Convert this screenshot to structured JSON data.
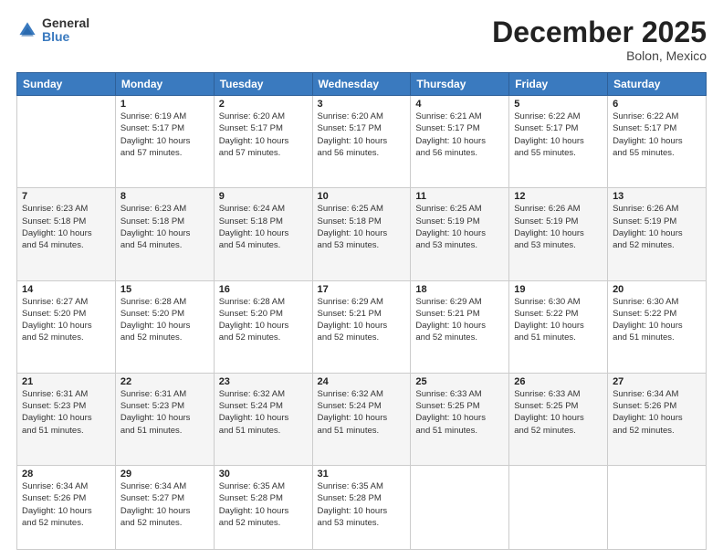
{
  "header": {
    "logo_general": "General",
    "logo_blue": "Blue",
    "month_year": "December 2025",
    "location": "Bolon, Mexico"
  },
  "days_of_week": [
    "Sunday",
    "Monday",
    "Tuesday",
    "Wednesday",
    "Thursday",
    "Friday",
    "Saturday"
  ],
  "weeks": [
    [
      {
        "day": "",
        "info": ""
      },
      {
        "day": "1",
        "info": "Sunrise: 6:19 AM\nSunset: 5:17 PM\nDaylight: 10 hours\nand 57 minutes."
      },
      {
        "day": "2",
        "info": "Sunrise: 6:20 AM\nSunset: 5:17 PM\nDaylight: 10 hours\nand 57 minutes."
      },
      {
        "day": "3",
        "info": "Sunrise: 6:20 AM\nSunset: 5:17 PM\nDaylight: 10 hours\nand 56 minutes."
      },
      {
        "day": "4",
        "info": "Sunrise: 6:21 AM\nSunset: 5:17 PM\nDaylight: 10 hours\nand 56 minutes."
      },
      {
        "day": "5",
        "info": "Sunrise: 6:22 AM\nSunset: 5:17 PM\nDaylight: 10 hours\nand 55 minutes."
      },
      {
        "day": "6",
        "info": "Sunrise: 6:22 AM\nSunset: 5:17 PM\nDaylight: 10 hours\nand 55 minutes."
      }
    ],
    [
      {
        "day": "7",
        "info": "Sunrise: 6:23 AM\nSunset: 5:18 PM\nDaylight: 10 hours\nand 54 minutes."
      },
      {
        "day": "8",
        "info": "Sunrise: 6:23 AM\nSunset: 5:18 PM\nDaylight: 10 hours\nand 54 minutes."
      },
      {
        "day": "9",
        "info": "Sunrise: 6:24 AM\nSunset: 5:18 PM\nDaylight: 10 hours\nand 54 minutes."
      },
      {
        "day": "10",
        "info": "Sunrise: 6:25 AM\nSunset: 5:18 PM\nDaylight: 10 hours\nand 53 minutes."
      },
      {
        "day": "11",
        "info": "Sunrise: 6:25 AM\nSunset: 5:19 PM\nDaylight: 10 hours\nand 53 minutes."
      },
      {
        "day": "12",
        "info": "Sunrise: 6:26 AM\nSunset: 5:19 PM\nDaylight: 10 hours\nand 53 minutes."
      },
      {
        "day": "13",
        "info": "Sunrise: 6:26 AM\nSunset: 5:19 PM\nDaylight: 10 hours\nand 52 minutes."
      }
    ],
    [
      {
        "day": "14",
        "info": "Sunrise: 6:27 AM\nSunset: 5:20 PM\nDaylight: 10 hours\nand 52 minutes."
      },
      {
        "day": "15",
        "info": "Sunrise: 6:28 AM\nSunset: 5:20 PM\nDaylight: 10 hours\nand 52 minutes."
      },
      {
        "day": "16",
        "info": "Sunrise: 6:28 AM\nSunset: 5:20 PM\nDaylight: 10 hours\nand 52 minutes."
      },
      {
        "day": "17",
        "info": "Sunrise: 6:29 AM\nSunset: 5:21 PM\nDaylight: 10 hours\nand 52 minutes."
      },
      {
        "day": "18",
        "info": "Sunrise: 6:29 AM\nSunset: 5:21 PM\nDaylight: 10 hours\nand 52 minutes."
      },
      {
        "day": "19",
        "info": "Sunrise: 6:30 AM\nSunset: 5:22 PM\nDaylight: 10 hours\nand 51 minutes."
      },
      {
        "day": "20",
        "info": "Sunrise: 6:30 AM\nSunset: 5:22 PM\nDaylight: 10 hours\nand 51 minutes."
      }
    ],
    [
      {
        "day": "21",
        "info": "Sunrise: 6:31 AM\nSunset: 5:23 PM\nDaylight: 10 hours\nand 51 minutes."
      },
      {
        "day": "22",
        "info": "Sunrise: 6:31 AM\nSunset: 5:23 PM\nDaylight: 10 hours\nand 51 minutes."
      },
      {
        "day": "23",
        "info": "Sunrise: 6:32 AM\nSunset: 5:24 PM\nDaylight: 10 hours\nand 51 minutes."
      },
      {
        "day": "24",
        "info": "Sunrise: 6:32 AM\nSunset: 5:24 PM\nDaylight: 10 hours\nand 51 minutes."
      },
      {
        "day": "25",
        "info": "Sunrise: 6:33 AM\nSunset: 5:25 PM\nDaylight: 10 hours\nand 51 minutes."
      },
      {
        "day": "26",
        "info": "Sunrise: 6:33 AM\nSunset: 5:25 PM\nDaylight: 10 hours\nand 52 minutes."
      },
      {
        "day": "27",
        "info": "Sunrise: 6:34 AM\nSunset: 5:26 PM\nDaylight: 10 hours\nand 52 minutes."
      }
    ],
    [
      {
        "day": "28",
        "info": "Sunrise: 6:34 AM\nSunset: 5:26 PM\nDaylight: 10 hours\nand 52 minutes."
      },
      {
        "day": "29",
        "info": "Sunrise: 6:34 AM\nSunset: 5:27 PM\nDaylight: 10 hours\nand 52 minutes."
      },
      {
        "day": "30",
        "info": "Sunrise: 6:35 AM\nSunset: 5:28 PM\nDaylight: 10 hours\nand 52 minutes."
      },
      {
        "day": "31",
        "info": "Sunrise: 6:35 AM\nSunset: 5:28 PM\nDaylight: 10 hours\nand 53 minutes."
      },
      {
        "day": "",
        "info": ""
      },
      {
        "day": "",
        "info": ""
      },
      {
        "day": "",
        "info": ""
      }
    ]
  ]
}
